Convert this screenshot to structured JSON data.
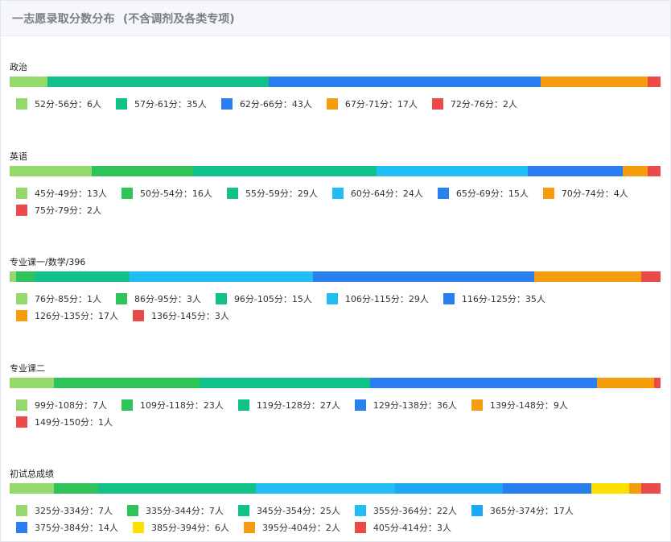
{
  "header": {
    "title": "一志愿录取分数分布",
    "note": "(不含调剂及各类专项)"
  },
  "chart_data": [
    {
      "type": "bar",
      "subject": "政治",
      "categories": [
        "52分-56分",
        "57分-61分",
        "62分-66分",
        "67分-71分",
        "72分-76分"
      ],
      "values": [
        6,
        35,
        43,
        17,
        2
      ],
      "colors": [
        "#95d96c",
        "#12c08a",
        "#2a7ff0",
        "#f59d0e",
        "#ea4a4a"
      ],
      "legend": [
        "52分-56分：6人",
        "57分-61分：35人",
        "62分-66分：43人",
        "67分-71分：17人",
        "72分-76分：2人"
      ],
      "orientation": "stacked-horizontal-100%"
    },
    {
      "type": "bar",
      "subject": "英语",
      "categories": [
        "45分-49分",
        "50分-54分",
        "55分-59分",
        "60分-64分",
        "65分-69分",
        "70分-74分",
        "75分-79分"
      ],
      "values": [
        13,
        16,
        29,
        24,
        15,
        4,
        2
      ],
      "colors": [
        "#95d96c",
        "#2ec45a",
        "#12c08a",
        "#21bdf4",
        "#2a7ff0",
        "#f59d0e",
        "#ea4a4a"
      ],
      "legend": [
        "45分-49分：13人",
        "50分-54分：16人",
        "55分-59分：29人",
        "60分-64分：24人",
        "65分-69分：15人",
        "70分-74分：4人",
        "75分-79分：2人"
      ],
      "orientation": "stacked-horizontal-100%"
    },
    {
      "type": "bar",
      "subject": "专业课一/数学/396",
      "categories": [
        "76分-85分",
        "86分-95分",
        "96分-105分",
        "106分-115分",
        "116分-125分",
        "126分-135分",
        "136分-145分"
      ],
      "values": [
        1,
        3,
        15,
        29,
        35,
        17,
        3
      ],
      "colors": [
        "#95d96c",
        "#2ec45a",
        "#12c08a",
        "#21bdf4",
        "#2a7ff0",
        "#f59d0e",
        "#ea4a4a"
      ],
      "legend": [
        "76分-85分：1人",
        "86分-95分：3人",
        "96分-105分：15人",
        "106分-115分：29人",
        "116分-125分：35人",
        "126分-135分：17人",
        "136分-145分：3人"
      ],
      "orientation": "stacked-horizontal-100%"
    },
    {
      "type": "bar",
      "subject": "专业课二",
      "categories": [
        "99分-108分",
        "109分-118分",
        "119分-128分",
        "129分-138分",
        "139分-148分",
        "149分-150分"
      ],
      "values": [
        7,
        23,
        27,
        36,
        9,
        1
      ],
      "colors": [
        "#95d96c",
        "#2ec45a",
        "#12c08a",
        "#2a7ff0",
        "#f59d0e",
        "#ea4a4a"
      ],
      "legend": [
        "99分-108分：7人",
        "109分-118分：23人",
        "119分-128分：27人",
        "129分-138分：36人",
        "139分-148分：9人",
        "149分-150分：1人"
      ],
      "orientation": "stacked-horizontal-100%"
    },
    {
      "type": "bar",
      "subject": "初试总成绩",
      "categories": [
        "325分-334分",
        "335分-344分",
        "345分-354分",
        "355分-364分",
        "365分-374分",
        "375分-384分",
        "385分-394分",
        "395分-404分",
        "405分-414分"
      ],
      "values": [
        7,
        7,
        25,
        22,
        17,
        14,
        6,
        2,
        3
      ],
      "colors": [
        "#95d96c",
        "#2ec45a",
        "#12c08a",
        "#21bdf4",
        "#1ea7f5",
        "#2a7ff0",
        "#fce100",
        "#f59d0e",
        "#ea4a4a"
      ],
      "legend": [
        "325分-334分：7人",
        "335分-344分：7人",
        "345分-354分：25人",
        "355分-364分：22人",
        "365分-374分：17人",
        "375分-384分：14人",
        "385分-394分：6人",
        "395分-404分：2人",
        "405分-414分：3人"
      ],
      "orientation": "stacked-horizontal-100%"
    }
  ]
}
